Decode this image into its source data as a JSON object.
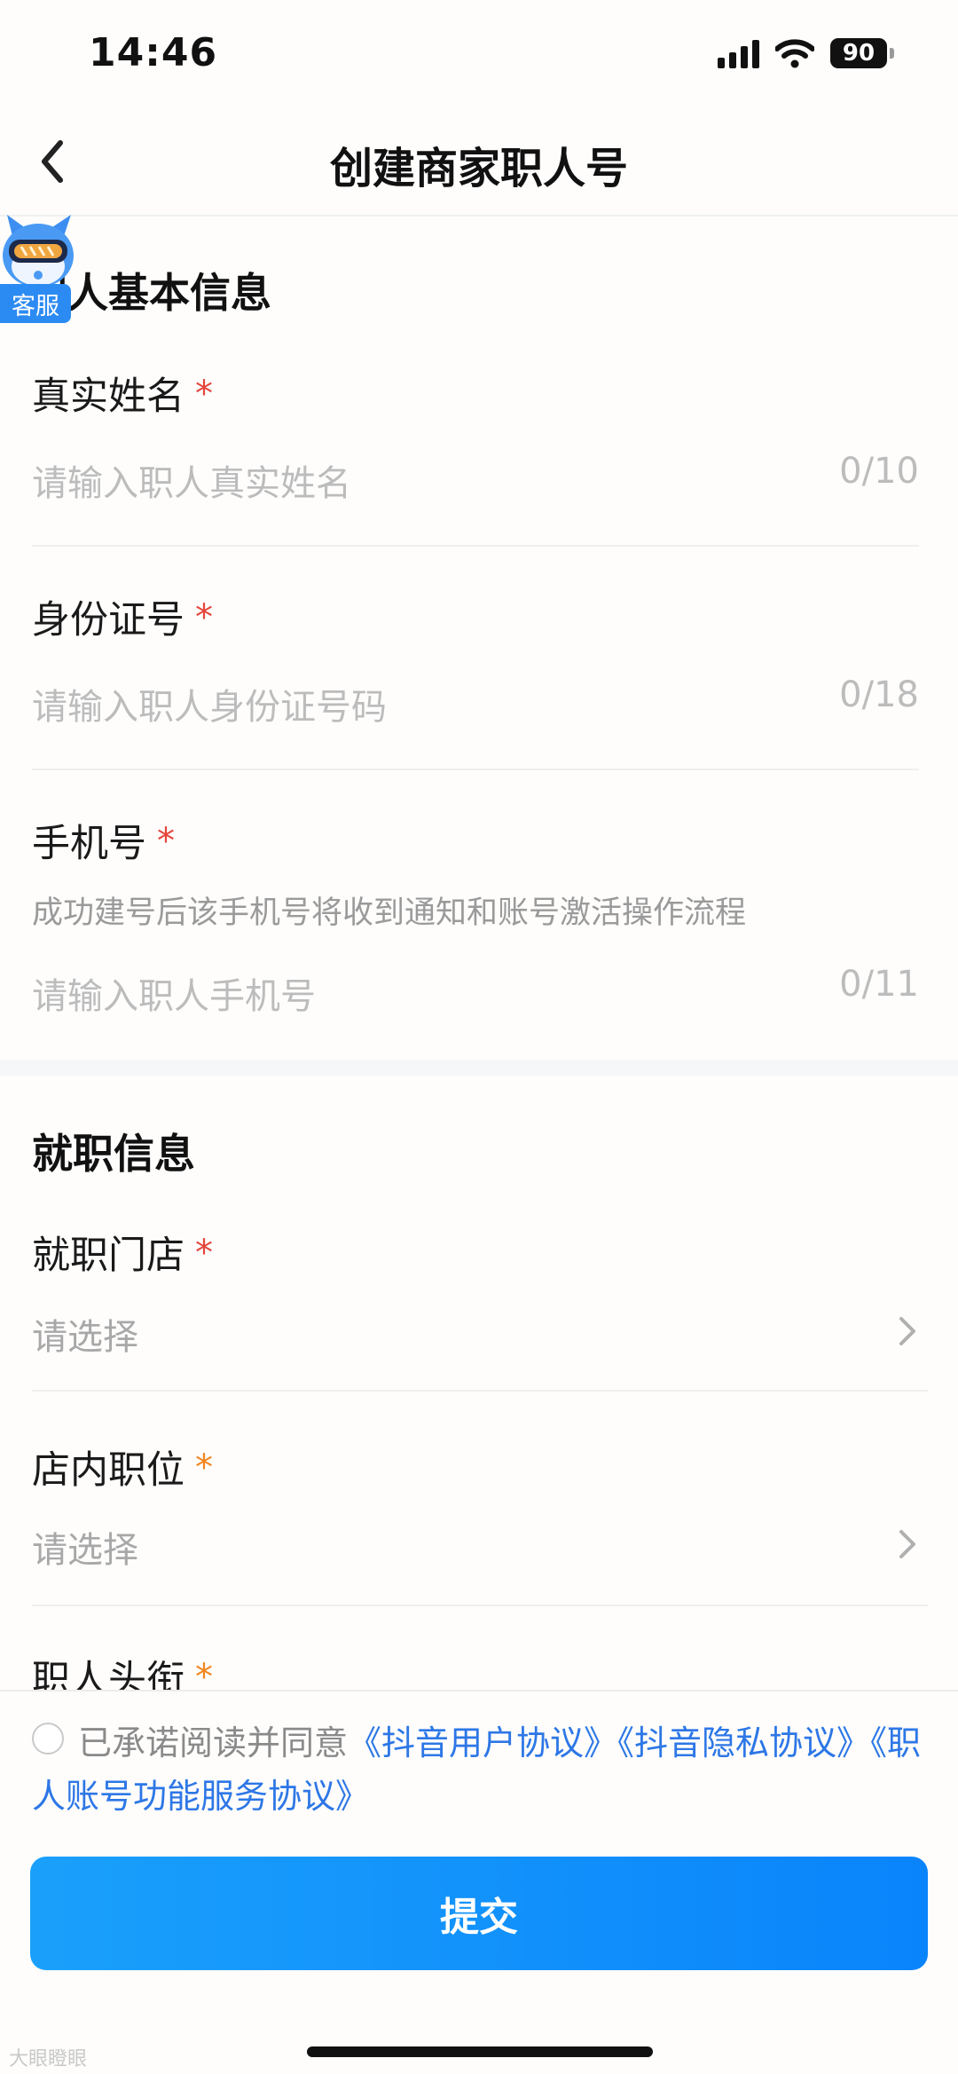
{
  "status_bar": {
    "time": "14:46",
    "battery": "90"
  },
  "header": {
    "title": "创建商家职人号",
    "back_icon": "chevron-left-icon"
  },
  "customer_service": {
    "label": "客服"
  },
  "sections": {
    "basic": {
      "title": "职人基本信息",
      "name": {
        "label": "真实姓名",
        "required": "*",
        "placeholder": "请输入职人真实姓名",
        "counter": "0/10"
      },
      "id_number": {
        "label": "身份证号",
        "required": "*",
        "placeholder": "请输入职人身份证号码",
        "counter": "0/18"
      },
      "phone": {
        "label": "手机号",
        "required": "*",
        "hint": "成功建号后该手机号将收到通知和账号激活操作流程",
        "placeholder": "请输入职人手机号",
        "counter": "0/11"
      }
    },
    "job": {
      "title": "就职信息",
      "store": {
        "label": "就职门店",
        "required": "*",
        "placeholder": "请选择"
      },
      "position": {
        "label": "店内职位",
        "required": "*",
        "placeholder": "请选择"
      },
      "headline": {
        "label": "职人头衔",
        "required": "*"
      }
    }
  },
  "agreement": {
    "prefix": "已承诺阅读并同意",
    "link_user": "《抖音用户协议》",
    "link_privacy": "《抖音隐私协议》",
    "link_service": "《职人账号功能服务协议》"
  },
  "submit_label": "提交",
  "watermark": "大眼瞪眼",
  "colors": {
    "primary": "#0a84fb",
    "link": "#2d77e6",
    "required_red": "#e5453b",
    "required_orange": "#f0861d"
  }
}
